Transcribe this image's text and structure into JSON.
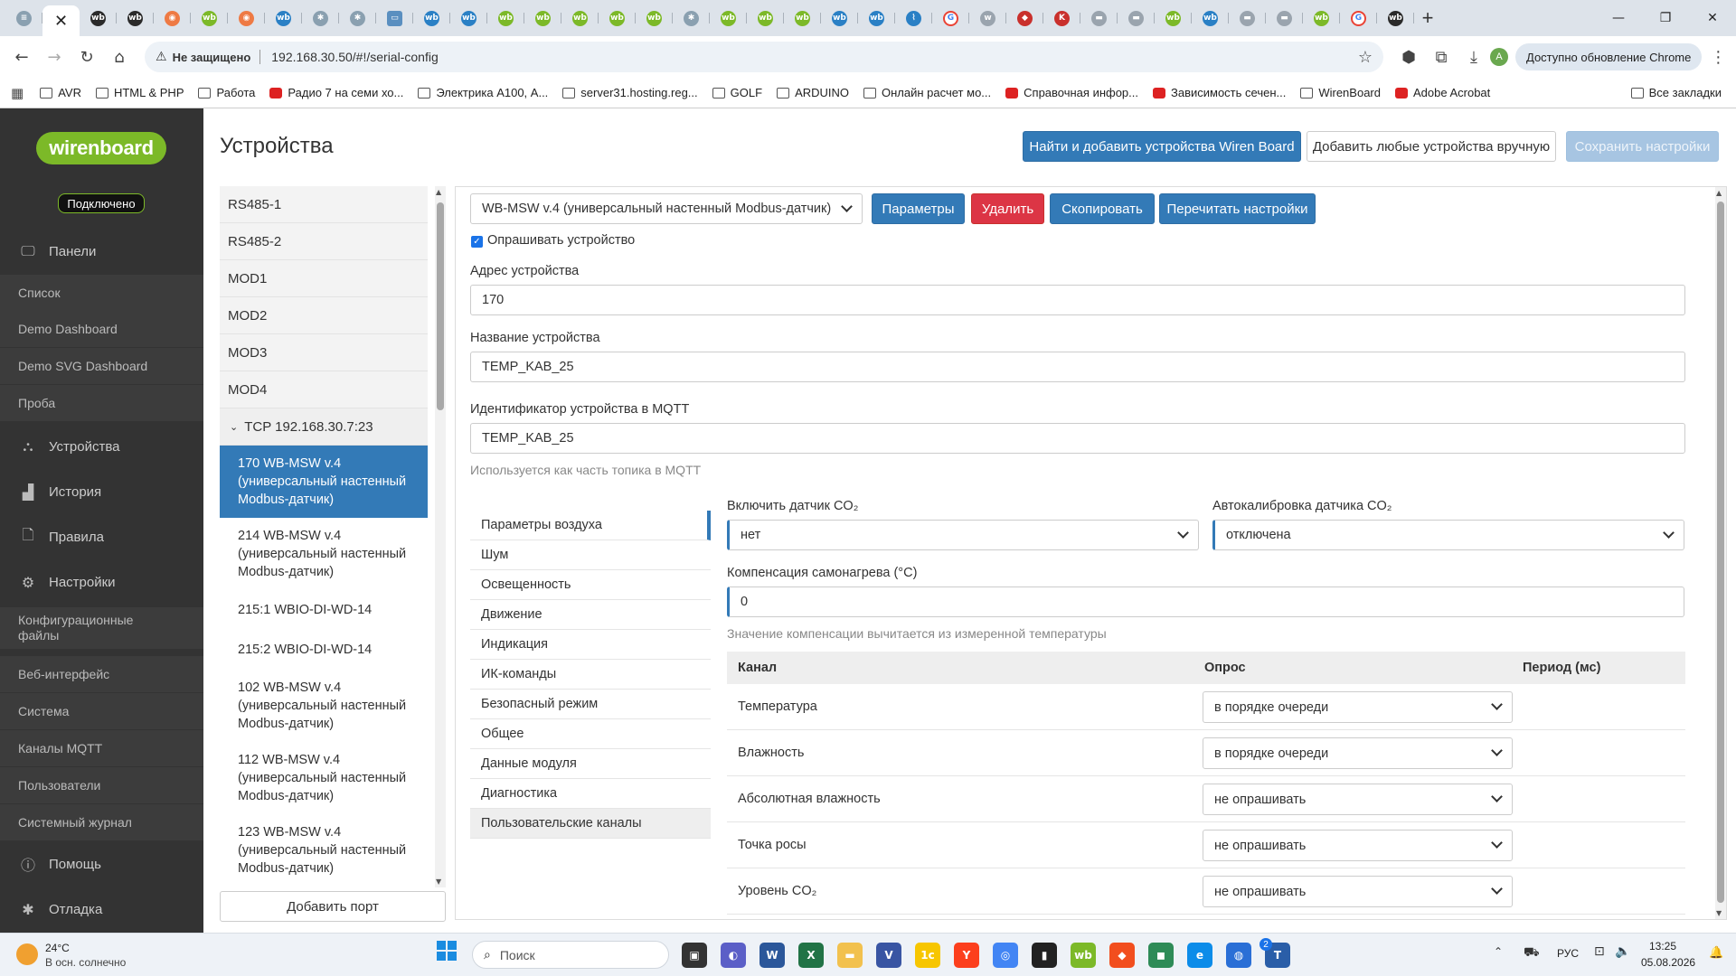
{
  "browser": {
    "tabs": [
      {
        "icon": "active-tab-close-icon"
      },
      {
        "icon": "wb-dark-favicon"
      },
      {
        "icon": "wb-dark-favicon"
      },
      {
        "icon": "orange-favicon"
      },
      {
        "icon": "wb-favicon"
      },
      {
        "icon": "orange-favicon"
      },
      {
        "icon": "wb-blue-favicon"
      },
      {
        "icon": "gear-favicon"
      },
      {
        "icon": "gear-favicon"
      },
      {
        "icon": "chat-favicon"
      },
      {
        "icon": "wb-blue-favicon"
      },
      {
        "icon": "wb-blue-favicon"
      },
      {
        "icon": "wb-favicon"
      },
      {
        "icon": "wb-favicon"
      },
      {
        "icon": "wb-favicon"
      },
      {
        "icon": "wb-favicon"
      },
      {
        "icon": "wb-favicon"
      },
      {
        "icon": "gear-favicon"
      },
      {
        "icon": "wb-favicon"
      },
      {
        "icon": "wb-favicon"
      },
      {
        "icon": "wb-favicon"
      },
      {
        "icon": "wb-blue-favicon"
      },
      {
        "icon": "wb-blue-favicon"
      },
      {
        "icon": "chart-favicon"
      },
      {
        "icon": "google-favicon"
      },
      {
        "icon": "w-favicon"
      },
      {
        "icon": "red-favicon"
      },
      {
        "icon": "k-favicon"
      },
      {
        "icon": "grey-favicon"
      },
      {
        "icon": "grey-favicon"
      },
      {
        "icon": "wb-favicon"
      },
      {
        "icon": "wb-blue-favicon"
      },
      {
        "icon": "grey-favicon"
      },
      {
        "icon": "grey-favicon"
      },
      {
        "icon": "wb-favicon"
      },
      {
        "icon": "google-favicon"
      },
      {
        "icon": "wb-dark-favicon"
      },
      {
        "icon": "grey-favicon"
      },
      {
        "icon": "wb-favicon"
      }
    ],
    "not_secure": "Не защищено",
    "url": "192.168.30.50/#!/serial-config",
    "update_label": "Доступно обновление Chrome",
    "avatar_letter": "A",
    "bookmarks": [
      {
        "label": "AVR"
      },
      {
        "label": "HTML & PHP"
      },
      {
        "label": "Работа"
      },
      {
        "label": "Радио 7 на семи хо..."
      },
      {
        "label": "Электрика А100, А..."
      },
      {
        "label": "server31.hosting.reg..."
      },
      {
        "label": "GOLF"
      },
      {
        "label": "ARDUINO"
      },
      {
        "label": "Онлайн расчет мо..."
      },
      {
        "label": "Справочная инфор..."
      },
      {
        "label": "Зависимость сечен..."
      },
      {
        "label": "WirenBoard"
      },
      {
        "label": "Adobe Acrobat"
      }
    ],
    "all_bookmarks": "Все закладки"
  },
  "sidebar": {
    "logo": "wirenboard",
    "status": "Подключено",
    "items": [
      {
        "label": "Панели",
        "icon": "monitor-icon"
      },
      {
        "label": "Список"
      },
      {
        "label": "Demo Dashboard"
      },
      {
        "label": "Demo SVG Dashboard"
      },
      {
        "label": "Проба"
      },
      {
        "label": "Устройства",
        "icon": "devices-icon"
      },
      {
        "label": "История",
        "icon": "bar-chart-icon"
      },
      {
        "label": "Правила",
        "icon": "file-icon"
      },
      {
        "label": "Настройки",
        "icon": "gear-icon"
      },
      {
        "label": "Конфигурационные файлы"
      },
      {
        "label": "Веб-интерфейс"
      },
      {
        "label": "Система"
      },
      {
        "label": "Каналы MQTT"
      },
      {
        "label": "Пользователи"
      },
      {
        "label": "Системный журнал"
      },
      {
        "label": "Помощь",
        "icon": "help-icon"
      },
      {
        "label": "Отладка",
        "icon": "bug-icon"
      }
    ]
  },
  "page": {
    "title": "Устройства",
    "btn_find": "Найти и добавить устройства Wiren Board",
    "btn_add_manual": "Добавить любые устройства вручную",
    "btn_save": "Сохранить настройки"
  },
  "ports": {
    "items": [
      "RS485-1",
      "RS485-2",
      "MOD1",
      "MOD2",
      "MOD3",
      "MOD4"
    ],
    "tcp": "TCP 192.168.30.7:23",
    "devices": [
      "170 WB-MSW v.4 (универсальный настенный Modbus-датчик)",
      "214 WB-MSW v.4 (универсальный настенный Modbus-датчик)",
      "215:1 WBIO-DI-WD-14",
      "215:2 WBIO-DI-WD-14",
      "102 WB-MSW v.4 (универсальный настенный Modbus-датчик)",
      "112 WB-MSW v.4 (универсальный настенный Modbus-датчик)",
      "123 WB-MSW v.4 (универсальный настенный Modbus-датчик)"
    ],
    "add_port": "Добавить порт"
  },
  "device": {
    "template": "WB-MSW v.4 (универсальный настенный Modbus-датчик)",
    "btn_params": "Параметры",
    "btn_delete": "Удалить",
    "btn_copy": "Скопировать",
    "btn_reread": "Перечитать настройки",
    "poll_label": "Опрашивать устройство",
    "poll_checked": true,
    "address_label": "Адрес устройства",
    "address": "170",
    "name_label": "Название устройства",
    "name": "TEMP_KAB_25",
    "mqtt_label": "Идентификатор устройства в MQTT",
    "mqtt_id": "TEMP_KAB_25",
    "mqtt_help": "Используется как часть топика в MQTT",
    "groups": [
      "Параметры воздуха",
      "Шум",
      "Освещенность",
      "Движение",
      "Индикация",
      "ИК-команды",
      "Безопасный режим",
      "Общее",
      "Данные модуля",
      "Диагностика",
      "Пользовательские каналы"
    ],
    "co2_enable_label": "Включить датчик CO₂",
    "co2_enable": "нет",
    "co2_autocal_label": "Автокалибровка датчика CO₂",
    "co2_autocal": "отключена",
    "comp_label": "Компенсация самонагрева (°C)",
    "comp_value": "0",
    "comp_help": "Значение компенсации вычитается из измеренной температуры",
    "table_headers": {
      "channel": "Канал",
      "poll": "Опрос",
      "period": "Период (мс)"
    },
    "channels": [
      {
        "name": "Температура",
        "poll": "в порядке очереди"
      },
      {
        "name": "Влажность",
        "poll": "в порядке очереди"
      },
      {
        "name": "Абсолютная влажность",
        "poll": "не опрашивать"
      },
      {
        "name": "Точка росы",
        "poll": "не опрашивать"
      },
      {
        "name": "Уровень CO₂",
        "poll": "не опрашивать"
      }
    ]
  },
  "taskbar": {
    "weather_temp": "24°C",
    "weather_desc": "В осн. солнечно",
    "search": "Поиск",
    "apps": [
      {
        "icon": "windows-start-icon"
      },
      {
        "icon": "search-icon"
      },
      {
        "icon": "task-view-icon"
      },
      {
        "icon": "teams-icon"
      },
      {
        "icon": "word-icon"
      },
      {
        "icon": "excel-icon"
      },
      {
        "icon": "explorer-icon"
      },
      {
        "icon": "visio-icon"
      },
      {
        "icon": "1c-icon"
      },
      {
        "icon": "yandex-browser-icon"
      },
      {
        "icon": "chrome-icon"
      },
      {
        "icon": "terminal-icon"
      },
      {
        "icon": "wb-app-icon"
      },
      {
        "icon": "figma-icon"
      },
      {
        "icon": "app-green-icon"
      },
      {
        "icon": "edge-icon"
      },
      {
        "icon": "app-blue-icon"
      },
      {
        "icon": "app-text-icon"
      }
    ],
    "badge_count": "2",
    "lang": "РУС",
    "time": "13:25",
    "date": "05.08.2026"
  }
}
